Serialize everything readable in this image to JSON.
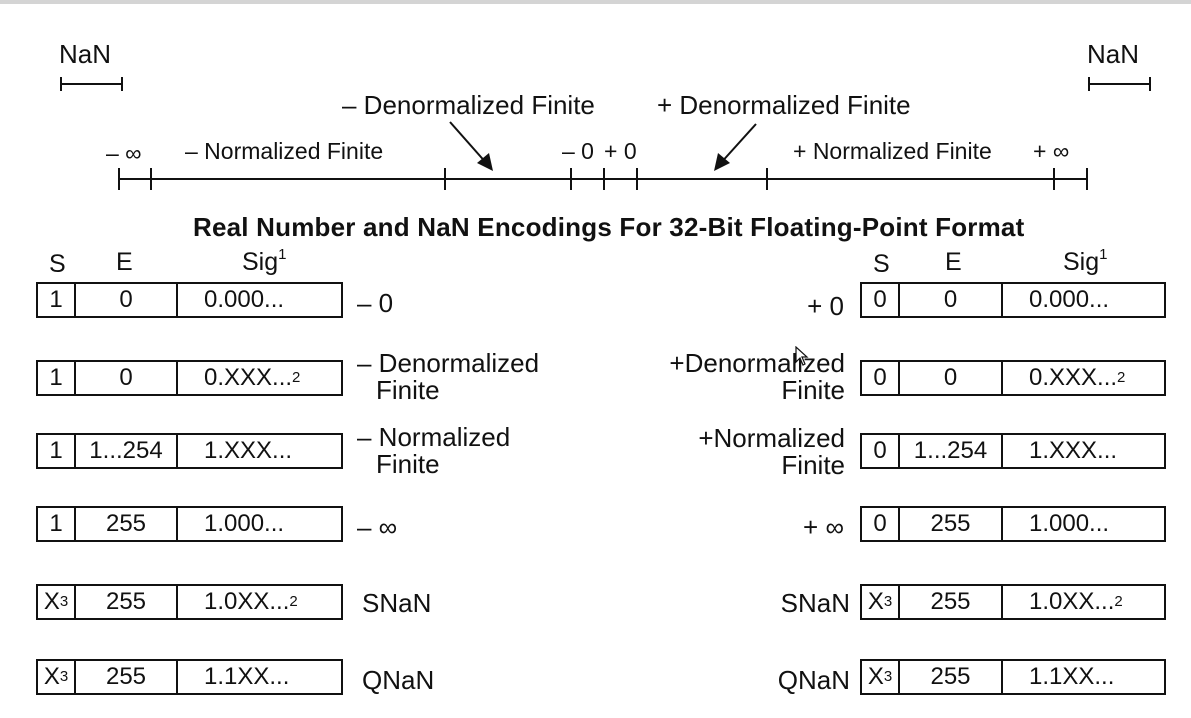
{
  "title": "Real Number and NaN Encodings For 32-Bit Floating-Point Format",
  "number_line": {
    "nan_left": "NaN",
    "nan_right": "NaN",
    "neg_inf": "– ∞",
    "pos_inf": "+ ∞",
    "neg_normalized": "– Normalized Finite",
    "pos_normalized": "+ Normalized Finite",
    "neg_denormalized": "– Denormalized Finite",
    "pos_denormalized": "+ Denormalized Finite",
    "neg_zero": "– 0",
    "pos_zero": "+ 0"
  },
  "headers": {
    "s": "S",
    "e": "E",
    "sig": "Sig",
    "sig_note": "1"
  },
  "left_rows": [
    {
      "s": "1",
      "s_note": "",
      "e": "0",
      "sig": "0.000...",
      "sig_note": "",
      "label": "– 0",
      "label2": ""
    },
    {
      "s": "1",
      "s_note": "",
      "e": "0",
      "sig": "0.XXX...",
      "sig_note": "2",
      "label": "– Denormalized",
      "label2": "Finite"
    },
    {
      "s": "1",
      "s_note": "",
      "e": "1...254",
      "sig": "1.XXX...",
      "sig_note": "",
      "label": "– Normalized",
      "label2": "Finite"
    },
    {
      "s": "1",
      "s_note": "",
      "e": "255",
      "sig": "1.000...",
      "sig_note": "",
      "label": "– ∞",
      "label2": ""
    },
    {
      "s": "X",
      "s_note": "3",
      "e": "255",
      "sig": "1.0XX...",
      "sig_note": "2",
      "label": "SNaN",
      "label2": ""
    },
    {
      "s": "X",
      "s_note": "3",
      "e": "255",
      "sig": "1.1XX...",
      "sig_note": "",
      "label": "QNaN",
      "label2": ""
    }
  ],
  "right_rows": [
    {
      "s": "0",
      "s_note": "",
      "e": "0",
      "sig": "0.000...",
      "sig_note": "",
      "label": "+ 0",
      "label2": ""
    },
    {
      "s": "0",
      "s_note": "",
      "e": "0",
      "sig": "0.XXX...",
      "sig_note": "2",
      "label": "+Denormalized",
      "label2": "Finite"
    },
    {
      "s": "0",
      "s_note": "",
      "e": "1...254",
      "sig": "1.XXX...",
      "sig_note": "",
      "label": "+Normalized",
      "label2": "Finite"
    },
    {
      "s": "0",
      "s_note": "",
      "e": "255",
      "sig": "1.000...",
      "sig_note": "",
      "label": "+ ∞",
      "label2": ""
    },
    {
      "s": "X",
      "s_note": "3",
      "e": "255",
      "sig": "1.0XX...",
      "sig_note": "2",
      "label": "SNaN",
      "label2": ""
    },
    {
      "s": "X",
      "s_note": "3",
      "e": "255",
      "sig": "1.1XX...",
      "sig_note": "",
      "label": "QNaN",
      "label2": ""
    }
  ]
}
